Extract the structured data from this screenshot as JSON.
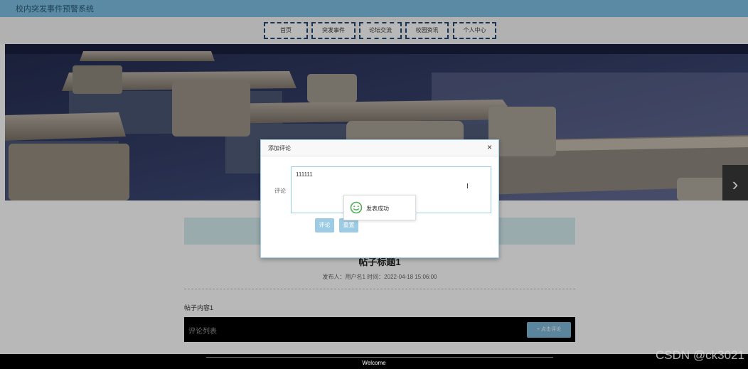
{
  "header": {
    "site_title": "校内突发事件预警系统"
  },
  "nav": {
    "items": [
      {
        "label": "首页"
      },
      {
        "label": "突发事件"
      },
      {
        "label": "论坛交流"
      },
      {
        "label": "校园资讯"
      },
      {
        "label": "个人中心"
      }
    ]
  },
  "banner": {
    "next_icon": "chevron-right-icon"
  },
  "post": {
    "title": "帖子标题1",
    "meta": "发布人：用户名1  时间：2022-04-18 15:06:00",
    "content": "帖子内容1",
    "comment_list_label": "评论列表",
    "add_comment_label": "+ 点击评论"
  },
  "dialog": {
    "title": "添加评论",
    "field_label": "评论",
    "textarea_value": "111111",
    "submit_label": "评论",
    "reset_label": "重置"
  },
  "toast": {
    "message": "发表成功"
  },
  "footer": {
    "text": "Welcome"
  },
  "watermark": {
    "text": "CSDN @ck3021"
  },
  "colors": {
    "header": "#7fc1e3",
    "nav_border": "#234a76",
    "button": "#9ccbe3",
    "toast_icon": "#4caf50"
  }
}
